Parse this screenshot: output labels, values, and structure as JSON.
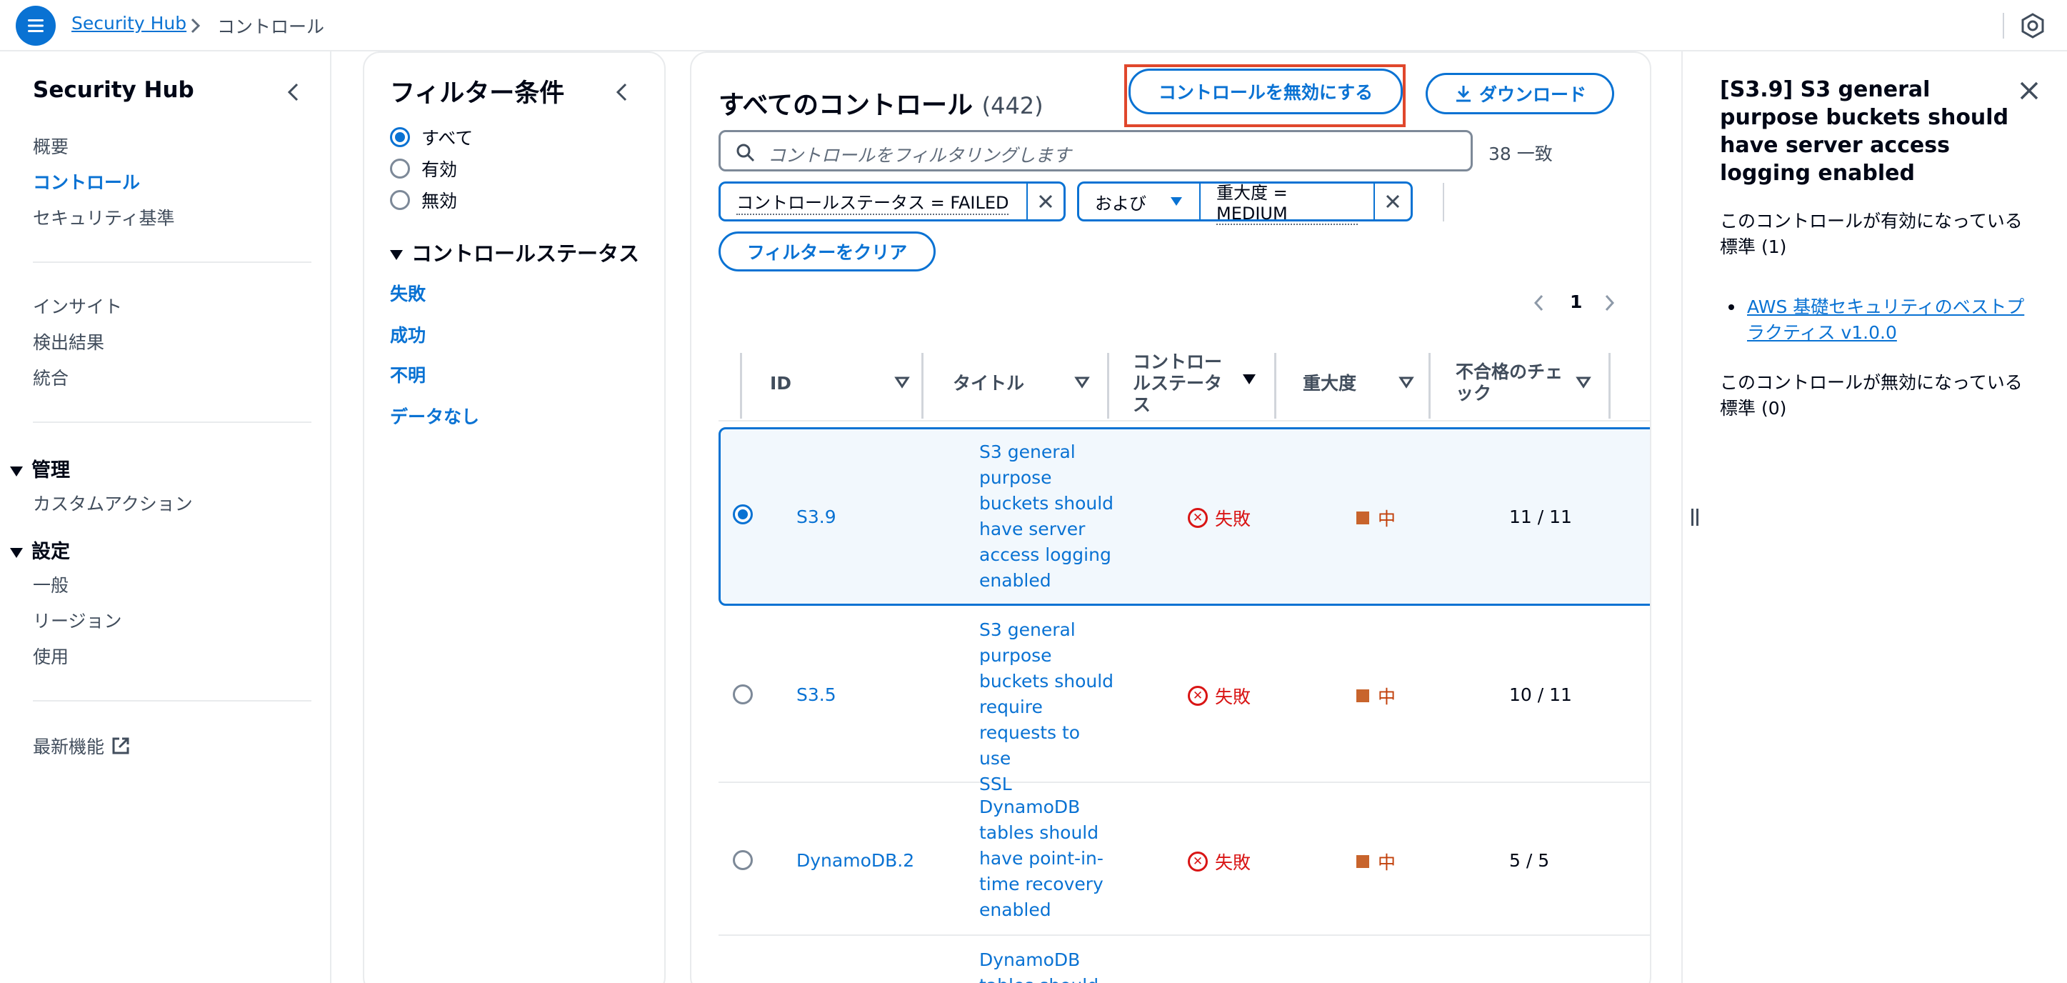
{
  "header": {
    "breadcrumb_link": "Security Hub",
    "breadcrumb_current": "コントロール"
  },
  "nav": {
    "title": "Security Hub",
    "items_top": [
      "概要",
      "コントロール",
      "セキュリティ基準"
    ],
    "items_mid": [
      "インサイト",
      "検出結果",
      "統合"
    ],
    "group_admin": "管理",
    "admin_items": [
      "カスタムアクション"
    ],
    "group_settings": "設定",
    "settings_items": [
      "一般",
      "リージョン",
      "使用"
    ],
    "whats_new": "最新機能"
  },
  "filter_panel": {
    "title": "フィルター条件",
    "radios": [
      {
        "label": "すべて",
        "checked": true
      },
      {
        "label": "有効",
        "checked": false
      },
      {
        "label": "無効",
        "checked": false
      }
    ],
    "section_title": "コントロールステータス",
    "status_links": [
      "失敗",
      "成功",
      "不明",
      "データなし"
    ]
  },
  "main": {
    "title": "すべてのコントロール",
    "count": "(442)",
    "disable_button": "コントロールを無効にする",
    "download_button": "ダウンロード",
    "search_placeholder": "コントロールをフィルタリングします",
    "match_count": "38 一致",
    "token1": "コントロールステータス = FAILED",
    "token_operator": "および",
    "token2": "重大度 = MEDIUM",
    "clear_filters": "フィルターをクリア",
    "page": "1",
    "columns": [
      "ID",
      "タイトル",
      "コントロールステータス",
      "重大度",
      "不合格のチェック"
    ],
    "column_lines": {
      "status": [
        "コントロー",
        "ルステータ",
        "ス"
      ],
      "checks": [
        "不合格のチェ",
        "ック"
      ]
    },
    "rows": [
      {
        "id": "S3.9",
        "title_lines": [
          "S3 general",
          "purpose",
          "buckets should",
          "have server",
          "access logging",
          "enabled"
        ],
        "status": "失敗",
        "severity": "中",
        "checks": "11 / 11",
        "selected": true
      },
      {
        "id": "S3.5",
        "title_lines": [
          "S3 general",
          "purpose",
          "buckets should",
          "require",
          "requests to use",
          "SSL"
        ],
        "status": "失敗",
        "severity": "中",
        "checks": "10 / 11",
        "selected": false
      },
      {
        "id": "DynamoDB.2",
        "title_lines": [
          "DynamoDB",
          "tables should",
          "have point-in-",
          "time recovery",
          "enabled"
        ],
        "status": "失敗",
        "severity": "中",
        "checks": "5 / 5",
        "selected": false
      },
      {
        "id": "",
        "title_lines": [
          "DynamoDB",
          "tables should"
        ],
        "status": "",
        "severity": "",
        "checks": "",
        "selected": false
      }
    ]
  },
  "detail": {
    "title": "[S3.9] S3 general purpose buckets should have server access logging enabled",
    "enabled_label": "このコントロールが有効になっている標準 (1)",
    "enabled_standards": [
      "AWS 基礎セキュリティのベストプラクティス v1.0.0"
    ],
    "disabled_label": "このコントロールが無効になっている標準 (0)"
  },
  "colors": {
    "accent": "#0972d3",
    "failed": "#d91515",
    "medium": "#c8642c",
    "highlight": "#e0472c"
  }
}
